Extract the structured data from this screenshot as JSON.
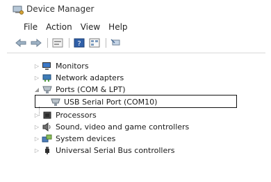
{
  "window": {
    "title": "Device Manager"
  },
  "menu": [
    {
      "label": "File"
    },
    {
      "label": "Action"
    },
    {
      "label": "View"
    },
    {
      "label": "Help"
    }
  ],
  "toolbar": {
    "icons": [
      "back-arrow-icon",
      "forward-arrow-icon",
      "properties-icon",
      "help-icon",
      "view-icon",
      "scan-hardware-icon"
    ]
  },
  "tree": {
    "items": [
      {
        "label": "Monitors",
        "icon": "monitor-icon",
        "expander": "collapsed"
      },
      {
        "label": "Network adapters",
        "icon": "network-adapter-icon",
        "expander": "collapsed"
      },
      {
        "label": "Ports (COM & LPT)",
        "icon": "port-icon",
        "expander": "expanded"
      },
      {
        "label": "USB Serial Port (COM10)",
        "icon": "port-icon",
        "selected": true
      },
      {
        "label": "Processors",
        "icon": "processor-icon",
        "expander": "collapsed"
      },
      {
        "label": "Sound, video and game controllers",
        "icon": "speaker-icon",
        "expander": "collapsed"
      },
      {
        "label": "System devices",
        "icon": "system-devices-icon",
        "expander": "collapsed"
      },
      {
        "label": "Universal Serial Bus controllers",
        "icon": "usb-icon",
        "expander": "collapsed"
      }
    ]
  }
}
